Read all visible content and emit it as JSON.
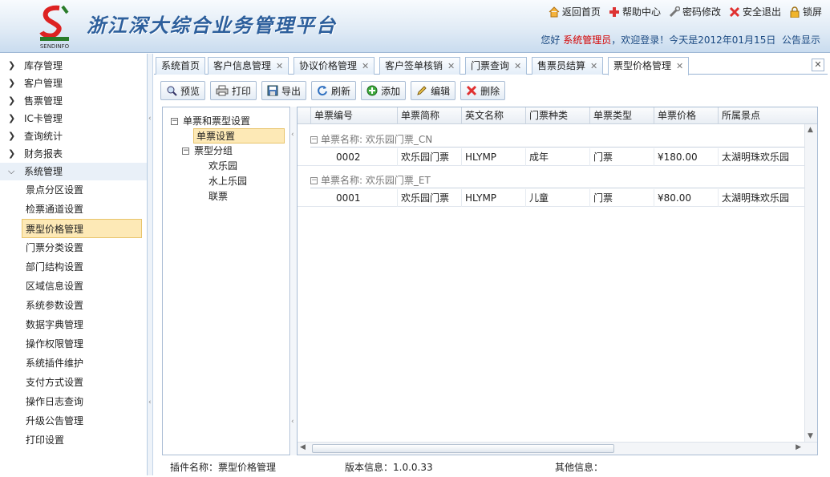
{
  "header": {
    "title": "浙江深大综合业务管理平台",
    "logo_text": "SENDINFO",
    "links": [
      {
        "label": "返回首页",
        "icon": "home-icon"
      },
      {
        "label": "帮助中心",
        "icon": "help-icon"
      },
      {
        "label": "密码修改",
        "icon": "wrench-icon"
      },
      {
        "label": "安全退出",
        "icon": "exit-icon"
      },
      {
        "label": "锁屏",
        "icon": "lock-icon"
      }
    ],
    "welcome_prefix": "您好",
    "user": "系统管理员",
    "welcome_suffix": "，欢迎登录！今天是2012年01月15日",
    "notice": "公告显示"
  },
  "sidebar": {
    "menus": [
      {
        "label": "库存管理"
      },
      {
        "label": "客户管理"
      },
      {
        "label": "售票管理"
      },
      {
        "label": "IC卡管理"
      },
      {
        "label": "查询统计"
      },
      {
        "label": "财务报表"
      },
      {
        "label": "系统管理"
      }
    ],
    "sub_items": [
      {
        "label": "景点分区设置"
      },
      {
        "label": "检票通道设置"
      },
      {
        "label": "票型价格管理"
      },
      {
        "label": "门票分类设置"
      },
      {
        "label": "部门结构设置"
      },
      {
        "label": "区域信息设置"
      },
      {
        "label": "系统参数设置"
      },
      {
        "label": "数据字典管理"
      },
      {
        "label": "操作权限管理"
      },
      {
        "label": "系统插件维护"
      },
      {
        "label": "支付方式设置"
      },
      {
        "label": "操作日志查询"
      },
      {
        "label": "升级公告管理"
      },
      {
        "label": "打印设置"
      }
    ]
  },
  "tabs": [
    {
      "label": "系统首页"
    },
    {
      "label": "客户信息管理"
    },
    {
      "label": "协议价格管理"
    },
    {
      "label": "客户签单核销"
    },
    {
      "label": "门票查询"
    },
    {
      "label": "售票员结算"
    },
    {
      "label": "票型价格管理"
    }
  ],
  "toolbar": {
    "preview": "预览",
    "print": "打印",
    "export": "导出",
    "refresh": "刷新",
    "add": "添加",
    "edit": "编辑",
    "delete": "删除"
  },
  "tree": {
    "root": "单票和票型设置",
    "single": "单票设置",
    "group": "票型分组",
    "children": [
      "欢乐园",
      "水上乐园",
      "联票"
    ]
  },
  "grid": {
    "columns": [
      "单票编号",
      "单票简称",
      "英文名称",
      "门票种类",
      "单票类型",
      "单票价格",
      "所属景点"
    ],
    "groups": [
      {
        "label": "单票名称: 欢乐园门票_CN",
        "rows": [
          [
            "0002",
            "欢乐园门票",
            "HLYMP",
            "成年",
            "门票",
            "¥180.00",
            "太湖明珠欢乐园"
          ]
        ]
      },
      {
        "label": "单票名称: 欢乐园门票_ET",
        "rows": [
          [
            "0001",
            "欢乐园门票",
            "HLYMP",
            "儿童",
            "门票",
            "¥80.00",
            "太湖明珠欢乐园"
          ]
        ]
      }
    ]
  },
  "status": {
    "plugin": "插件名称：票型价格管理",
    "version": "版本信息：1.0.0.33",
    "other": "其他信息："
  },
  "colors": {
    "user_highlight": "#d40000",
    "title": "#2d5f9c",
    "selected_bg": "#fde9b6"
  }
}
